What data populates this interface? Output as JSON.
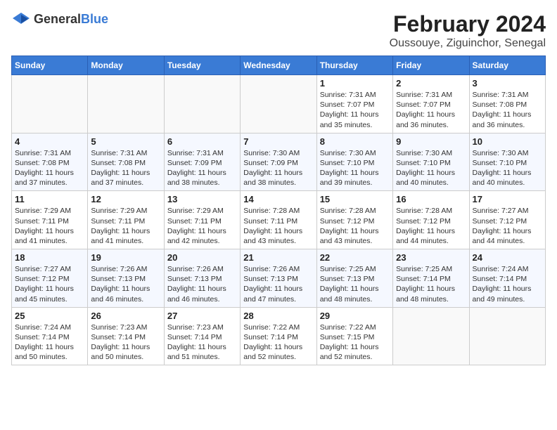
{
  "logo": {
    "general": "General",
    "blue": "Blue"
  },
  "title": "February 2024",
  "subtitle": "Oussouye, Ziguinchor, Senegal",
  "days": [
    "Sunday",
    "Monday",
    "Tuesday",
    "Wednesday",
    "Thursday",
    "Friday",
    "Saturday"
  ],
  "weeks": [
    [
      {
        "date": "",
        "info": ""
      },
      {
        "date": "",
        "info": ""
      },
      {
        "date": "",
        "info": ""
      },
      {
        "date": "",
        "info": ""
      },
      {
        "date": "1",
        "info": "Sunrise: 7:31 AM\nSunset: 7:07 PM\nDaylight: 11 hours\nand 35 minutes."
      },
      {
        "date": "2",
        "info": "Sunrise: 7:31 AM\nSunset: 7:07 PM\nDaylight: 11 hours\nand 36 minutes."
      },
      {
        "date": "3",
        "info": "Sunrise: 7:31 AM\nSunset: 7:08 PM\nDaylight: 11 hours\nand 36 minutes."
      }
    ],
    [
      {
        "date": "4",
        "info": "Sunrise: 7:31 AM\nSunset: 7:08 PM\nDaylight: 11 hours\nand 37 minutes."
      },
      {
        "date": "5",
        "info": "Sunrise: 7:31 AM\nSunset: 7:08 PM\nDaylight: 11 hours\nand 37 minutes."
      },
      {
        "date": "6",
        "info": "Sunrise: 7:31 AM\nSunset: 7:09 PM\nDaylight: 11 hours\nand 38 minutes."
      },
      {
        "date": "7",
        "info": "Sunrise: 7:30 AM\nSunset: 7:09 PM\nDaylight: 11 hours\nand 38 minutes."
      },
      {
        "date": "8",
        "info": "Sunrise: 7:30 AM\nSunset: 7:10 PM\nDaylight: 11 hours\nand 39 minutes."
      },
      {
        "date": "9",
        "info": "Sunrise: 7:30 AM\nSunset: 7:10 PM\nDaylight: 11 hours\nand 40 minutes."
      },
      {
        "date": "10",
        "info": "Sunrise: 7:30 AM\nSunset: 7:10 PM\nDaylight: 11 hours\nand 40 minutes."
      }
    ],
    [
      {
        "date": "11",
        "info": "Sunrise: 7:29 AM\nSunset: 7:11 PM\nDaylight: 11 hours\nand 41 minutes."
      },
      {
        "date": "12",
        "info": "Sunrise: 7:29 AM\nSunset: 7:11 PM\nDaylight: 11 hours\nand 41 minutes."
      },
      {
        "date": "13",
        "info": "Sunrise: 7:29 AM\nSunset: 7:11 PM\nDaylight: 11 hours\nand 42 minutes."
      },
      {
        "date": "14",
        "info": "Sunrise: 7:28 AM\nSunset: 7:11 PM\nDaylight: 11 hours\nand 43 minutes."
      },
      {
        "date": "15",
        "info": "Sunrise: 7:28 AM\nSunset: 7:12 PM\nDaylight: 11 hours\nand 43 minutes."
      },
      {
        "date": "16",
        "info": "Sunrise: 7:28 AM\nSunset: 7:12 PM\nDaylight: 11 hours\nand 44 minutes."
      },
      {
        "date": "17",
        "info": "Sunrise: 7:27 AM\nSunset: 7:12 PM\nDaylight: 11 hours\nand 44 minutes."
      }
    ],
    [
      {
        "date": "18",
        "info": "Sunrise: 7:27 AM\nSunset: 7:12 PM\nDaylight: 11 hours\nand 45 minutes."
      },
      {
        "date": "19",
        "info": "Sunrise: 7:26 AM\nSunset: 7:13 PM\nDaylight: 11 hours\nand 46 minutes."
      },
      {
        "date": "20",
        "info": "Sunrise: 7:26 AM\nSunset: 7:13 PM\nDaylight: 11 hours\nand 46 minutes."
      },
      {
        "date": "21",
        "info": "Sunrise: 7:26 AM\nSunset: 7:13 PM\nDaylight: 11 hours\nand 47 minutes."
      },
      {
        "date": "22",
        "info": "Sunrise: 7:25 AM\nSunset: 7:13 PM\nDaylight: 11 hours\nand 48 minutes."
      },
      {
        "date": "23",
        "info": "Sunrise: 7:25 AM\nSunset: 7:14 PM\nDaylight: 11 hours\nand 48 minutes."
      },
      {
        "date": "24",
        "info": "Sunrise: 7:24 AM\nSunset: 7:14 PM\nDaylight: 11 hours\nand 49 minutes."
      }
    ],
    [
      {
        "date": "25",
        "info": "Sunrise: 7:24 AM\nSunset: 7:14 PM\nDaylight: 11 hours\nand 50 minutes."
      },
      {
        "date": "26",
        "info": "Sunrise: 7:23 AM\nSunset: 7:14 PM\nDaylight: 11 hours\nand 50 minutes."
      },
      {
        "date": "27",
        "info": "Sunrise: 7:23 AM\nSunset: 7:14 PM\nDaylight: 11 hours\nand 51 minutes."
      },
      {
        "date": "28",
        "info": "Sunrise: 7:22 AM\nSunset: 7:14 PM\nDaylight: 11 hours\nand 52 minutes."
      },
      {
        "date": "29",
        "info": "Sunrise: 7:22 AM\nSunset: 7:15 PM\nDaylight: 11 hours\nand 52 minutes."
      },
      {
        "date": "",
        "info": ""
      },
      {
        "date": "",
        "info": ""
      }
    ]
  ]
}
